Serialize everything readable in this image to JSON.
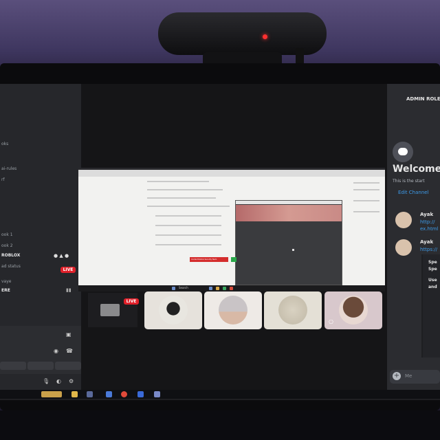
{
  "channels": {
    "items": [
      "oks",
      "ai-rules",
      "rf",
      "ook 1",
      "ook 2"
    ],
    "server": "ROBLOX",
    "voice_user": "vaye",
    "voice_status": "ad status",
    "user_tag": "ERE"
  },
  "badges": {
    "live_left": "LIVE",
    "live_tile": "LIVE"
  },
  "stream": {
    "red_button": "Contact Roblox Security Team",
    "search_label": "Search"
  },
  "chat": {
    "header": "ADMIN ROLE",
    "welcome": "Welcome",
    "subtitle": "This is the start",
    "edit_channel": "Edit Channel",
    "messages": [
      {
        "author": "Ayak",
        "text": "http://",
        "text2": "ex.html"
      },
      {
        "author": "Ayak",
        "text": "https://",
        "text2": ""
      }
    ],
    "embed_lines": [
      "Spe",
      "Spe",
      "Use",
      "and"
    ],
    "input_placeholder": "Me"
  },
  "colors": {
    "live": "#e0202a",
    "link": "#3d9be9",
    "accent": "#5865f2"
  }
}
